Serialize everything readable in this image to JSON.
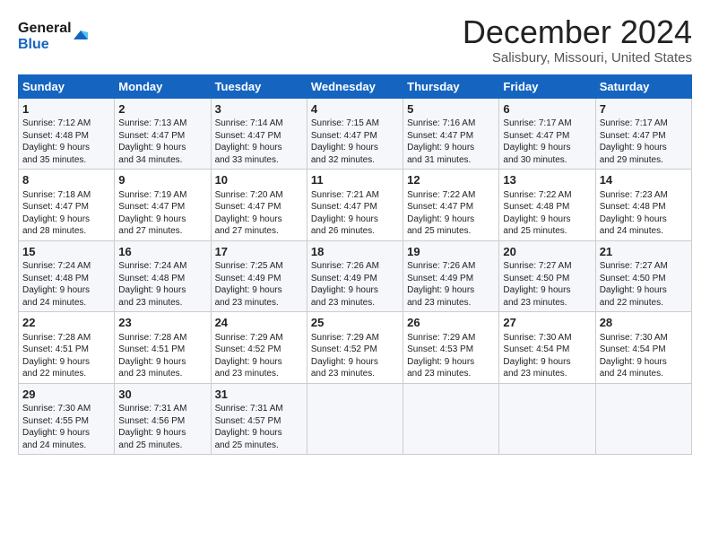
{
  "header": {
    "logo_line1": "General",
    "logo_line2": "Blue",
    "title": "December 2024",
    "subtitle": "Salisbury, Missouri, United States"
  },
  "weekdays": [
    "Sunday",
    "Monday",
    "Tuesday",
    "Wednesday",
    "Thursday",
    "Friday",
    "Saturday"
  ],
  "weeks": [
    [
      {
        "day": "1",
        "lines": [
          "Sunrise: 7:12 AM",
          "Sunset: 4:48 PM",
          "Daylight: 9 hours",
          "and 35 minutes."
        ]
      },
      {
        "day": "2",
        "lines": [
          "Sunrise: 7:13 AM",
          "Sunset: 4:47 PM",
          "Daylight: 9 hours",
          "and 34 minutes."
        ]
      },
      {
        "day": "3",
        "lines": [
          "Sunrise: 7:14 AM",
          "Sunset: 4:47 PM",
          "Daylight: 9 hours",
          "and 33 minutes."
        ]
      },
      {
        "day": "4",
        "lines": [
          "Sunrise: 7:15 AM",
          "Sunset: 4:47 PM",
          "Daylight: 9 hours",
          "and 32 minutes."
        ]
      },
      {
        "day": "5",
        "lines": [
          "Sunrise: 7:16 AM",
          "Sunset: 4:47 PM",
          "Daylight: 9 hours",
          "and 31 minutes."
        ]
      },
      {
        "day": "6",
        "lines": [
          "Sunrise: 7:17 AM",
          "Sunset: 4:47 PM",
          "Daylight: 9 hours",
          "and 30 minutes."
        ]
      },
      {
        "day": "7",
        "lines": [
          "Sunrise: 7:17 AM",
          "Sunset: 4:47 PM",
          "Daylight: 9 hours",
          "and 29 minutes."
        ]
      }
    ],
    [
      {
        "day": "8",
        "lines": [
          "Sunrise: 7:18 AM",
          "Sunset: 4:47 PM",
          "Daylight: 9 hours",
          "and 28 minutes."
        ]
      },
      {
        "day": "9",
        "lines": [
          "Sunrise: 7:19 AM",
          "Sunset: 4:47 PM",
          "Daylight: 9 hours",
          "and 27 minutes."
        ]
      },
      {
        "day": "10",
        "lines": [
          "Sunrise: 7:20 AM",
          "Sunset: 4:47 PM",
          "Daylight: 9 hours",
          "and 27 minutes."
        ]
      },
      {
        "day": "11",
        "lines": [
          "Sunrise: 7:21 AM",
          "Sunset: 4:47 PM",
          "Daylight: 9 hours",
          "and 26 minutes."
        ]
      },
      {
        "day": "12",
        "lines": [
          "Sunrise: 7:22 AM",
          "Sunset: 4:47 PM",
          "Daylight: 9 hours",
          "and 25 minutes."
        ]
      },
      {
        "day": "13",
        "lines": [
          "Sunrise: 7:22 AM",
          "Sunset: 4:48 PM",
          "Daylight: 9 hours",
          "and 25 minutes."
        ]
      },
      {
        "day": "14",
        "lines": [
          "Sunrise: 7:23 AM",
          "Sunset: 4:48 PM",
          "Daylight: 9 hours",
          "and 24 minutes."
        ]
      }
    ],
    [
      {
        "day": "15",
        "lines": [
          "Sunrise: 7:24 AM",
          "Sunset: 4:48 PM",
          "Daylight: 9 hours",
          "and 24 minutes."
        ]
      },
      {
        "day": "16",
        "lines": [
          "Sunrise: 7:24 AM",
          "Sunset: 4:48 PM",
          "Daylight: 9 hours",
          "and 23 minutes."
        ]
      },
      {
        "day": "17",
        "lines": [
          "Sunrise: 7:25 AM",
          "Sunset: 4:49 PM",
          "Daylight: 9 hours",
          "and 23 minutes."
        ]
      },
      {
        "day": "18",
        "lines": [
          "Sunrise: 7:26 AM",
          "Sunset: 4:49 PM",
          "Daylight: 9 hours",
          "and 23 minutes."
        ]
      },
      {
        "day": "19",
        "lines": [
          "Sunrise: 7:26 AM",
          "Sunset: 4:49 PM",
          "Daylight: 9 hours",
          "and 23 minutes."
        ]
      },
      {
        "day": "20",
        "lines": [
          "Sunrise: 7:27 AM",
          "Sunset: 4:50 PM",
          "Daylight: 9 hours",
          "and 23 minutes."
        ]
      },
      {
        "day": "21",
        "lines": [
          "Sunrise: 7:27 AM",
          "Sunset: 4:50 PM",
          "Daylight: 9 hours",
          "and 22 minutes."
        ]
      }
    ],
    [
      {
        "day": "22",
        "lines": [
          "Sunrise: 7:28 AM",
          "Sunset: 4:51 PM",
          "Daylight: 9 hours",
          "and 22 minutes."
        ]
      },
      {
        "day": "23",
        "lines": [
          "Sunrise: 7:28 AM",
          "Sunset: 4:51 PM",
          "Daylight: 9 hours",
          "and 23 minutes."
        ]
      },
      {
        "day": "24",
        "lines": [
          "Sunrise: 7:29 AM",
          "Sunset: 4:52 PM",
          "Daylight: 9 hours",
          "and 23 minutes."
        ]
      },
      {
        "day": "25",
        "lines": [
          "Sunrise: 7:29 AM",
          "Sunset: 4:52 PM",
          "Daylight: 9 hours",
          "and 23 minutes."
        ]
      },
      {
        "day": "26",
        "lines": [
          "Sunrise: 7:29 AM",
          "Sunset: 4:53 PM",
          "Daylight: 9 hours",
          "and 23 minutes."
        ]
      },
      {
        "day": "27",
        "lines": [
          "Sunrise: 7:30 AM",
          "Sunset: 4:54 PM",
          "Daylight: 9 hours",
          "and 23 minutes."
        ]
      },
      {
        "day": "28",
        "lines": [
          "Sunrise: 7:30 AM",
          "Sunset: 4:54 PM",
          "Daylight: 9 hours",
          "and 24 minutes."
        ]
      }
    ],
    [
      {
        "day": "29",
        "lines": [
          "Sunrise: 7:30 AM",
          "Sunset: 4:55 PM",
          "Daylight: 9 hours",
          "and 24 minutes."
        ]
      },
      {
        "day": "30",
        "lines": [
          "Sunrise: 7:31 AM",
          "Sunset: 4:56 PM",
          "Daylight: 9 hours",
          "and 25 minutes."
        ]
      },
      {
        "day": "31",
        "lines": [
          "Sunrise: 7:31 AM",
          "Sunset: 4:57 PM",
          "Daylight: 9 hours",
          "and 25 minutes."
        ]
      },
      null,
      null,
      null,
      null
    ]
  ]
}
